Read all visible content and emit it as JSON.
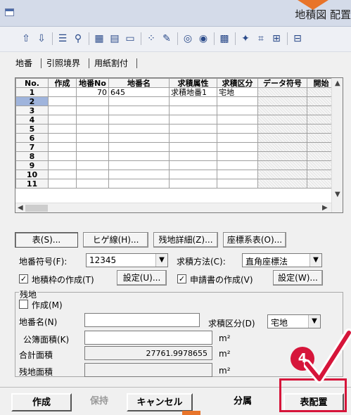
{
  "window": {
    "title": "地積図 配置"
  },
  "tabs": [
    "地番",
    "引照境界",
    "用紙割付"
  ],
  "grid": {
    "columns": [
      "No.",
      "作成",
      "地番No",
      "地番名",
      "求積属性",
      "求積区分",
      "データ符号",
      "開始"
    ],
    "rows": [
      [
        "1",
        "",
        "70",
        "645",
        "求積地番1",
        "宅地",
        "",
        ""
      ],
      [
        "2",
        "",
        "",
        "",
        "",
        "",
        "",
        ""
      ],
      [
        "3",
        "",
        "",
        "",
        "",
        "",
        "",
        ""
      ],
      [
        "4",
        "",
        "",
        "",
        "",
        "",
        "",
        ""
      ],
      [
        "5",
        "",
        "",
        "",
        "",
        "",
        "",
        ""
      ],
      [
        "6",
        "",
        "",
        "",
        "",
        "",
        "",
        ""
      ],
      [
        "7",
        "",
        "",
        "",
        "",
        "",
        "",
        ""
      ],
      [
        "8",
        "",
        "",
        "",
        "",
        "",
        "",
        ""
      ],
      [
        "9",
        "",
        "",
        "",
        "",
        "",
        "",
        ""
      ],
      [
        "10",
        "",
        "",
        "",
        "",
        "",
        "",
        ""
      ],
      [
        "11",
        "",
        "",
        "",
        "",
        "",
        "",
        ""
      ]
    ]
  },
  "actions": {
    "table": "表(S)...",
    "beard": "ヒゲ線(H)...",
    "remainder_detail": "残地詳細(Z)...",
    "coord_system": "座標系表(O)..."
  },
  "form": {
    "lot_code_label": "地番符号(F):",
    "lot_code_value": "12345",
    "method_label": "求積方法(C):",
    "method_value": "直角座標法",
    "frame_check_label": "地積枠の作成(T)",
    "frame_settings": "設定(U)...",
    "application_check_label": "申請書の作成(V)",
    "application_settings": "設定(W)..."
  },
  "remainder": {
    "group_label": "残地",
    "create_label": "作成(M)",
    "lot_name_label": "地番名(N)",
    "category_label": "求積区分(D)",
    "category_value": "宅地",
    "registry_area_label": "公簿面積(K)",
    "total_area_label": "合計面積",
    "total_area_value": "27761.9978655",
    "remaining_area_label": "残地面積",
    "unit": "m²"
  },
  "footer": {
    "create": "作成",
    "save": "保持",
    "cancel": "キャンセル",
    "subordinate": "分属",
    "place_table": "表配置"
  },
  "callout": {
    "number": "4"
  },
  "colors": {
    "accent_red": "#d6153a",
    "accent_orange": "#e8742a"
  }
}
